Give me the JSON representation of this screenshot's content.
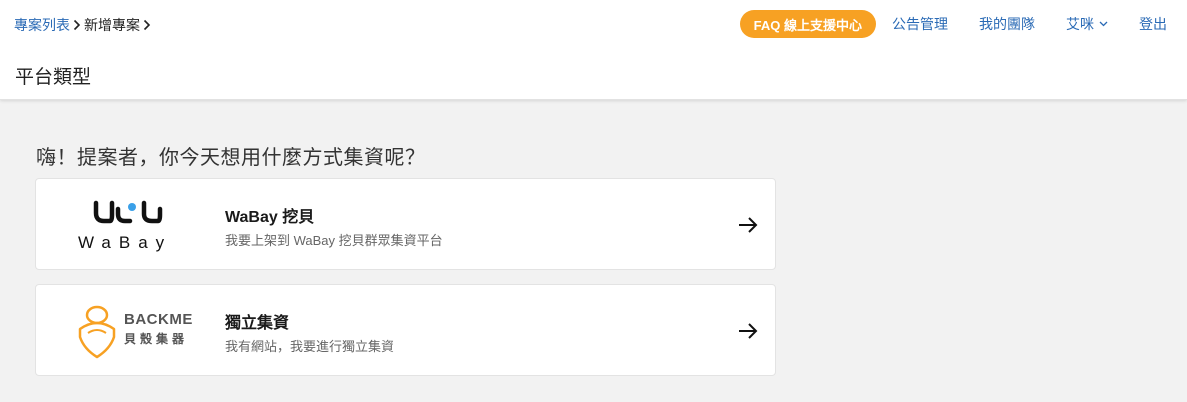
{
  "breadcrumb": {
    "project_list": "專案列表",
    "new_project": "新增專案"
  },
  "page_title": "平台類型",
  "nav": {
    "faq": "FAQ 線上支援中心",
    "announcements": "公告管理",
    "my_team": "我的團隊",
    "user": "艾咪",
    "logout": "登出"
  },
  "question": "嗨！提案者，你今天想用什麼方式集資呢？",
  "options": [
    {
      "title": "WaBay 挖貝",
      "subtitle": "我要上架到 WaBay 挖貝群眾集資平台",
      "logo_text": "WaBay"
    },
    {
      "title": "獨立集資",
      "subtitle": "我有網站，我要進行獨立集資",
      "logo_en": "BACKME",
      "logo_zh": "貝殼集器"
    }
  ],
  "colors": {
    "accent": "#f7a123",
    "link": "#2a6ab5",
    "wabay_dot": "#3aa0e8"
  }
}
